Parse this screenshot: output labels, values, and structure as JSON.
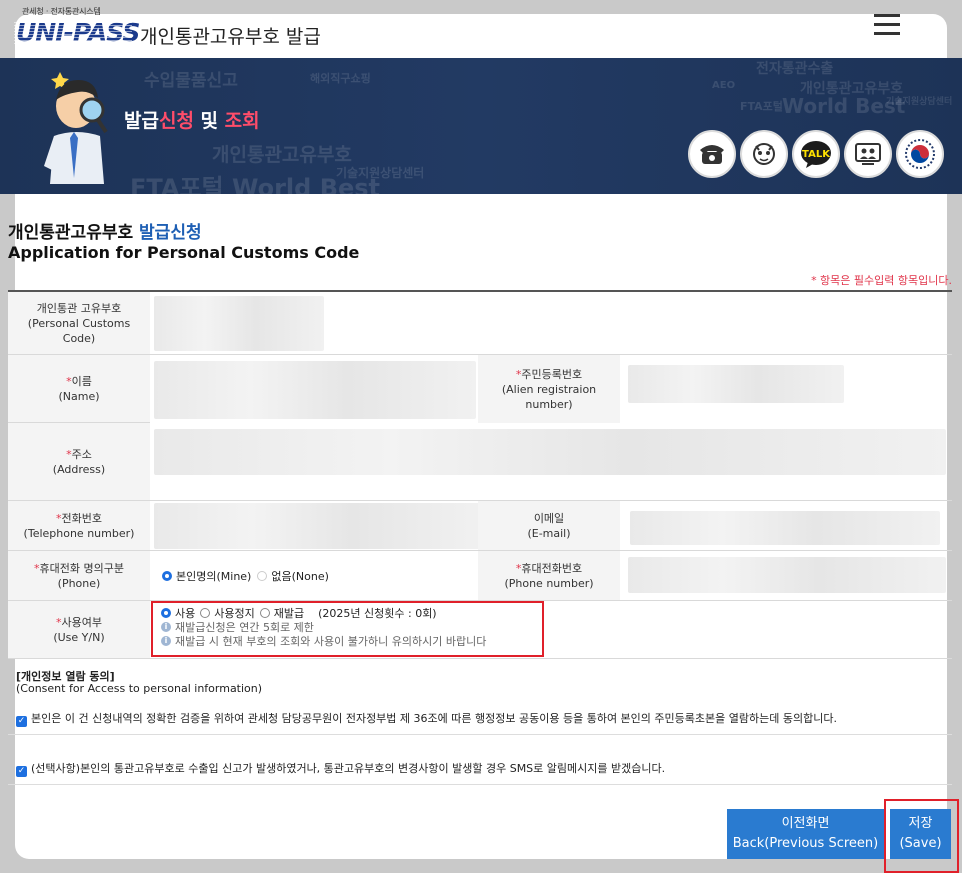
{
  "header": {
    "agency_text": "관세청 · 전자통관시스템",
    "logo_text": "UNI-PASS",
    "title": "개인통관고유부호 발급",
    "menu_icon": "hamburger-menu-icon"
  },
  "banner": {
    "title_part1": "발급",
    "title_part2": "신청",
    "title_part3": " 및 ",
    "title_part4": "조회",
    "watermark_words": [
      "수입물품신고",
      "해외직구쇼핑",
      "개인통관고유부호",
      "FTA포털",
      "World Best",
      "기술지원상담센터",
      "전자통관수출",
      "AEO",
      "관세청",
      "FTA포털 World Best"
    ],
    "channels": [
      {
        "name": "phone-icon"
      },
      {
        "name": "chatbot-icon"
      },
      {
        "name": "kakao-talk-icon",
        "label": "TALK"
      },
      {
        "name": "remote-support-icon"
      },
      {
        "name": "government-emblem-icon"
      }
    ]
  },
  "page": {
    "title_ko_prefix": "개인통관고유부호 ",
    "title_ko_blue": "발급신청",
    "title_en": "Application for Personal Customs Code",
    "required_note": "* 항목은 필수입력 항목입니다."
  },
  "form": {
    "customs_code": {
      "label_ko": "개인통관 고유부호",
      "label_en": "(Personal Customs Code)"
    },
    "name": {
      "label_ko": "이름",
      "label_en": "(Name)"
    },
    "alien_reg": {
      "label_ko": "주민등록번호",
      "label_en": "(Alien registraion number)"
    },
    "address": {
      "label_ko": "주소",
      "label_en": "(Address)"
    },
    "telephone": {
      "label_ko": "전화번호",
      "label_en": "(Telephone number)"
    },
    "email": {
      "label_ko": "이메일",
      "label_en": "(E-mail)"
    },
    "phone_owner": {
      "label_ko": "휴대전화 명의구분",
      "label_en": "(Phone)",
      "options": [
        {
          "label": "본인명의(Mine)",
          "selected": true
        },
        {
          "label": "없음(None)",
          "selected": false
        }
      ]
    },
    "mobile": {
      "label_ko": "휴대전화번호",
      "label_en": "(Phone number)"
    },
    "use_yn": {
      "label_ko": "사용여부",
      "label_en": "(Use Y/N)",
      "options": [
        {
          "label": "사용",
          "selected": true
        },
        {
          "label": "사용정지",
          "selected": false
        },
        {
          "label": "재발급",
          "selected": false
        }
      ],
      "count_text": "(2025년 신청횟수 : 0회)",
      "info1": "재발급신청은 연간 5회로 제한",
      "info2": "재발급 시 현재 부호의 조회와 사용이 불가하니 유의하시기 바랍니다"
    }
  },
  "consent": {
    "title": "[개인정보 열람 동의]",
    "subtitle": "(Consent for Access to personal information)",
    "item1": "본인은 이 건 신청내역의 정확한 검증을 위하여 관세청 담당공무원이 전자정부법 제 36조에 따른 행정정보 공동이용 등을 통하여 본인의 주민등록초본을 열람하는데 동의합니다.",
    "item2": "(선택사항)본인의 통관고유부호로 수출입 신고가 발생하였거나, 통관고유부호의 변경사항이 발생할 경우 SMS로 알림메시지를 받겠습니다."
  },
  "buttons": {
    "back_ko": "이전화면",
    "back_en": "Back(Previous Screen)",
    "save_ko": "저장",
    "save_en": "(Save)"
  },
  "colors": {
    "brand_blue": "#1b3a8c",
    "banner_bg": "#1d3357",
    "accent_red": "#e0344a",
    "button_blue": "#2a7bd0"
  }
}
